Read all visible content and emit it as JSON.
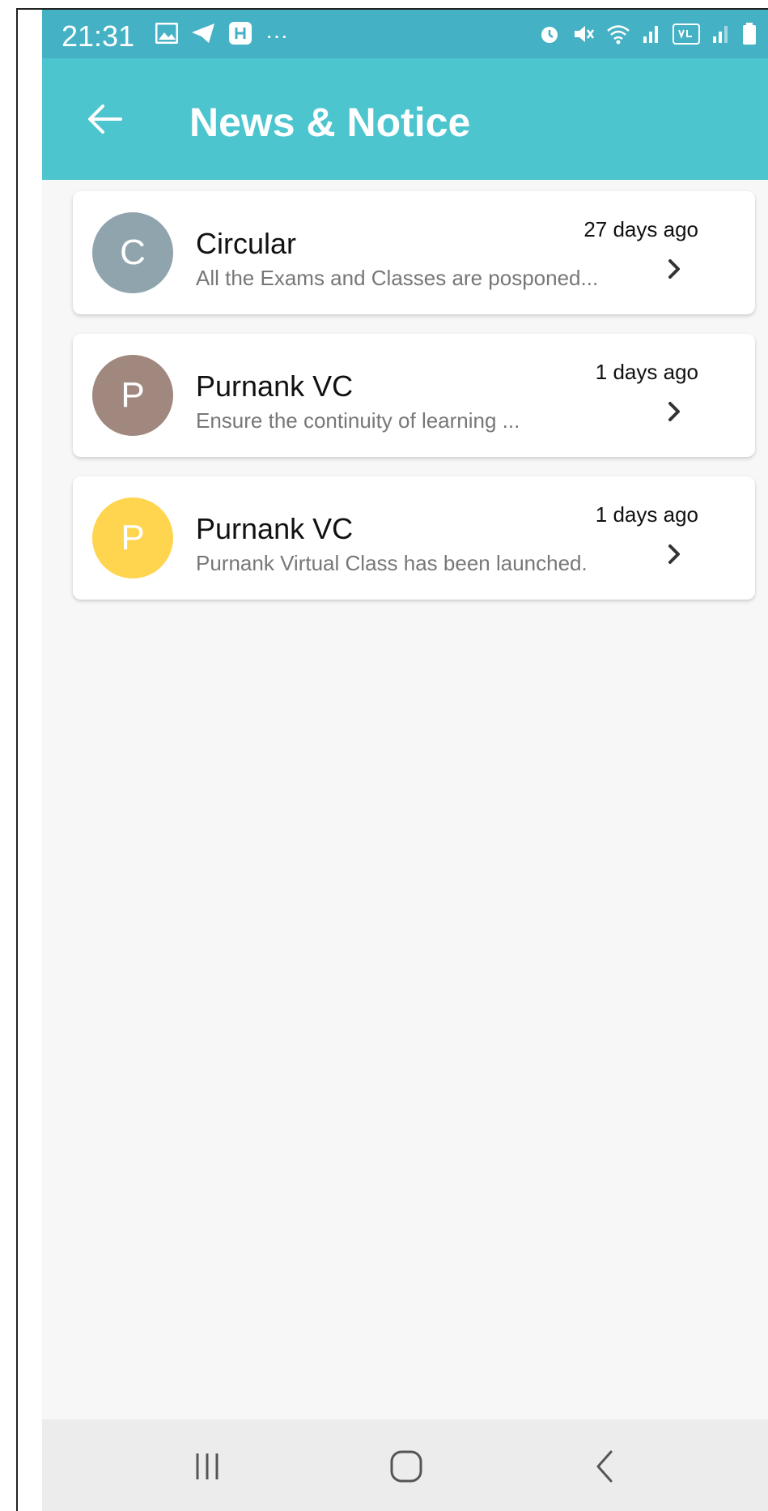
{
  "status_bar": {
    "time": "21:31",
    "left_icons": [
      "gallery-icon",
      "telegram-icon",
      "app-icon",
      "more-icon"
    ],
    "right_icons": [
      "alarm-icon",
      "mute-icon",
      "wifi-icon",
      "signal-icon",
      "volte-icon",
      "signal2-icon",
      "battery-icon"
    ]
  },
  "app_bar": {
    "title": "News & Notice"
  },
  "colors": {
    "accent": "#4cc5cf",
    "status": "#45b1c4",
    "avatar_c": "#90a4ae",
    "avatar_p1": "#a1887f",
    "avatar_p2": "#ffd54f"
  },
  "notices": [
    {
      "initial": "C",
      "title": "Circular",
      "preview": "All the Exams and Classes are posponed...",
      "time": "27 days ago",
      "avatar_color": "#90a4ae"
    },
    {
      "initial": "P",
      "title": "Purnank VC",
      "preview": "Ensure the continuity of learning ...",
      "time": "1 days ago",
      "avatar_color": "#a1887f"
    },
    {
      "initial": "P",
      "title": "Purnank VC",
      "preview": "Purnank Virtual Class has been launched.",
      "time": "1 days ago",
      "avatar_color": "#ffd54f"
    }
  ],
  "nav_bar": {
    "buttons": [
      "recent-apps-icon",
      "home-icon",
      "back-icon"
    ]
  }
}
